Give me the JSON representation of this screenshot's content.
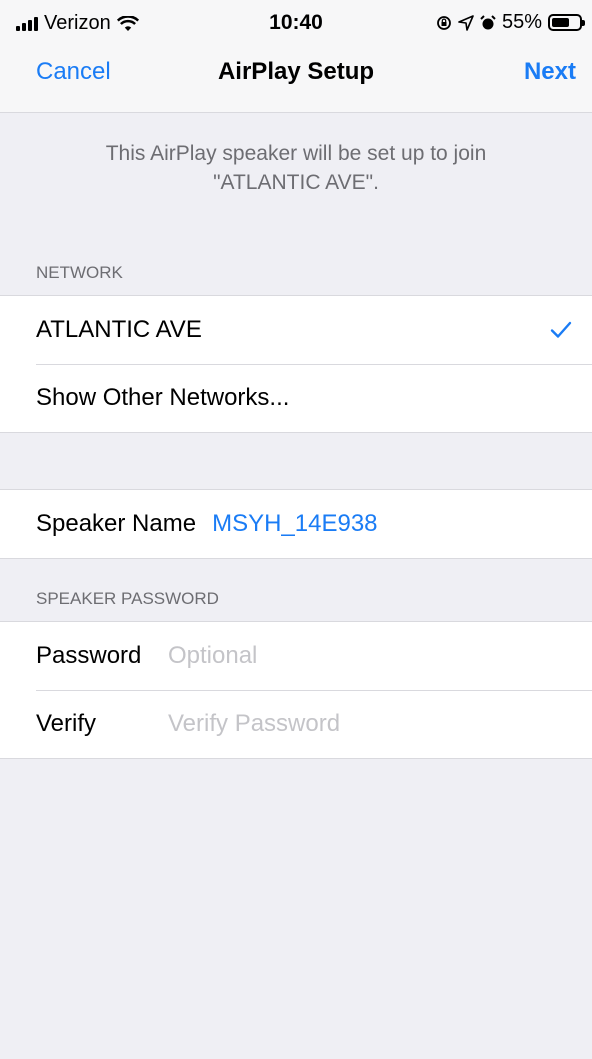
{
  "status_bar": {
    "carrier": "Verizon",
    "time": "10:40",
    "battery_percent": "55%",
    "battery_level": 0.55
  },
  "nav": {
    "cancel": "Cancel",
    "title": "AirPlay Setup",
    "next": "Next"
  },
  "info_text": "This AirPlay speaker will be set up to join \"ATLANTIC AVE\".",
  "network": {
    "header": "NETWORK",
    "selected": "ATLANTIC AVE",
    "other": "Show Other Networks..."
  },
  "speaker": {
    "label": "Speaker Name",
    "value": "MSYH_14E938"
  },
  "password_section": {
    "header": "SPEAKER PASSWORD",
    "password_label": "Password",
    "password_placeholder": "Optional",
    "verify_label": "Verify",
    "verify_placeholder": "Verify Password"
  },
  "colors": {
    "accent": "#1a7cf5",
    "background": "#efeff4"
  }
}
